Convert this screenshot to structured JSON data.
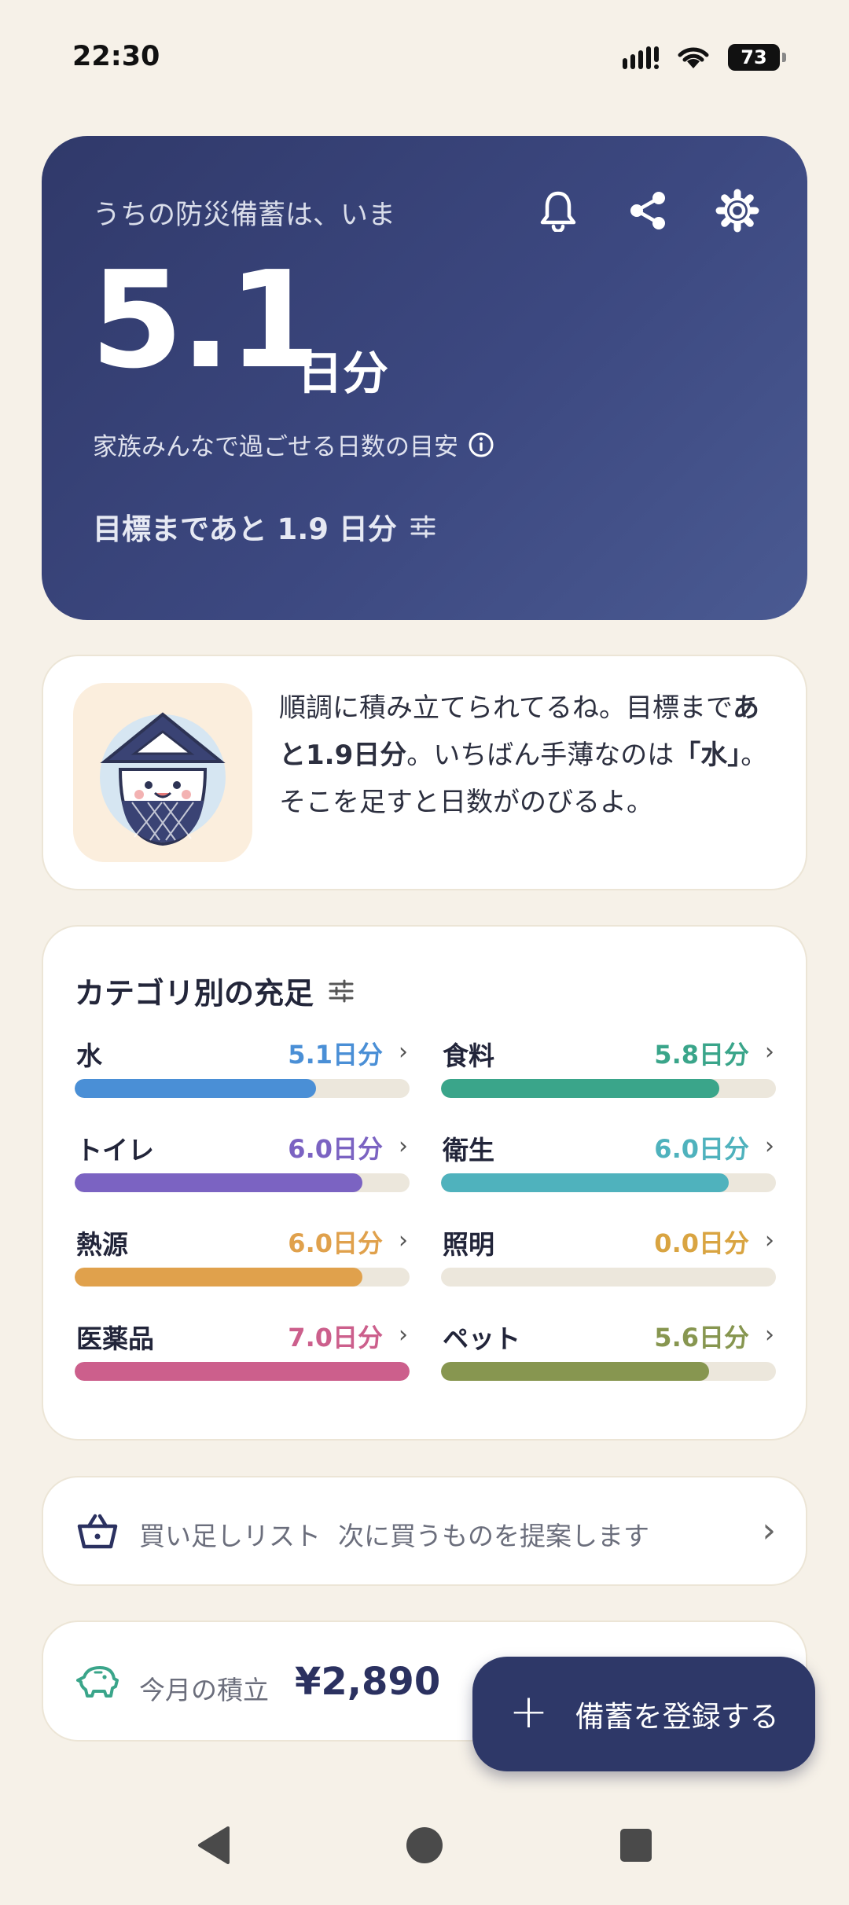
{
  "status_bar": {
    "time": "22:30",
    "battery": "73"
  },
  "hero": {
    "lead": "うちの防災備蓄は、いま",
    "days_value": "5.1",
    "days_unit": "日分",
    "description": "家族みんなで過ごせる日数の目安",
    "goal_text": "目標まであと 1.9 日分",
    "actions": [
      "bell-icon",
      "share-icon",
      "gear-icon"
    ]
  },
  "advice": {
    "line1": "順調に積み立てられてるね。目標まで",
    "bold1": "あと1.9日分",
    "mid": "。いちばん手薄なのは",
    "bold2": "「水」",
    "end": "。そこを足すと日数がのびるよ。"
  },
  "categories": {
    "title": "カテゴリ別の充足",
    "items": [
      {
        "name": "水",
        "value": "5.1日分",
        "level": 0.72,
        "color": "#4a8fd6"
      },
      {
        "name": "食料",
        "value": "5.8日分",
        "level": 0.83,
        "color": "#3aa58a"
      },
      {
        "name": "トイレ",
        "value": "6.0日分",
        "level": 0.86,
        "color": "#7b63c2"
      },
      {
        "name": "衛生",
        "value": "6.0日分",
        "level": 0.86,
        "color": "#4fb2bd"
      },
      {
        "name": "熱源",
        "value": "6.0日分",
        "level": 0.86,
        "color": "#e0a14c"
      },
      {
        "name": "照明",
        "value": "0.0日分",
        "level": 0.0,
        "color": "#d9a441"
      },
      {
        "name": "医薬品",
        "value": "7.0日分",
        "level": 1.0,
        "color": "#cc5f8c"
      },
      {
        "name": "ペット",
        "value": "5.6日分",
        "level": 0.8,
        "color": "#879650"
      }
    ]
  },
  "shopping": {
    "label": "買い足しリスト",
    "hint": "次に買うものを提案します"
  },
  "savings": {
    "label": "今月の積立",
    "amount": "¥2,890"
  },
  "fab": {
    "label": "備蓄を登録する"
  }
}
